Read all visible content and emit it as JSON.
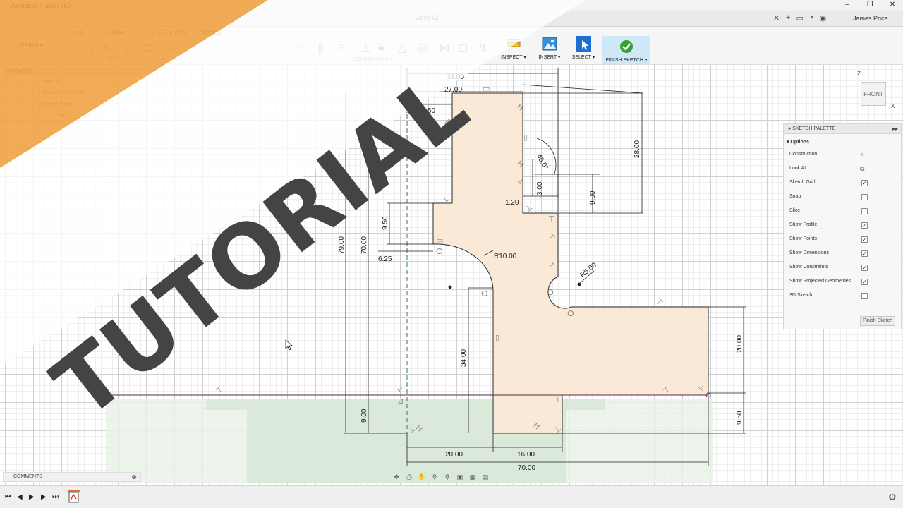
{
  "window": {
    "title": "Autodesk Fusion 360",
    "controls": [
      "–",
      "❐",
      "✕"
    ]
  },
  "tabs": {
    "doc_tab": "Valve v2",
    "user": "James Price"
  },
  "toolbar": {
    "workspace_tabs": [
      "SOLID",
      "SURFACE",
      "SHEET METAL",
      "TOOLS"
    ],
    "workspace_selector": "DESIGN ▾",
    "create_label": "CREATE ▾",
    "constraints_label": "CONSTRAINTS ▾",
    "inspect_label": "INSPECT ▾",
    "insert_label": "INSERT ▾",
    "select_label": "SELECT ▾",
    "finish_label": "FINISH SKETCH ▾"
  },
  "browser": {
    "header": "BROWSER",
    "items": [
      "Valve v2",
      "Document Settings",
      "Named Views",
      "Origin"
    ]
  },
  "comments": {
    "label": "COMMENTS"
  },
  "viewcube": {
    "face": "FRONT",
    "z_label": "Z",
    "x_label": "X"
  },
  "sketch_palette": {
    "header": "SKETCH PALETTE",
    "section": "Options",
    "options": [
      {
        "label": "Construction",
        "type": "icon",
        "icon": "construction-icon",
        "glyph": "<"
      },
      {
        "label": "Look At",
        "type": "icon",
        "icon": "look-at-icon",
        "glyph": "⧉"
      },
      {
        "label": "Sketch Grid",
        "type": "checkbox",
        "checked": true
      },
      {
        "label": "Snap",
        "type": "checkbox",
        "checked": false
      },
      {
        "label": "Slice",
        "type": "checkbox",
        "checked": false
      },
      {
        "label": "Show Profile",
        "type": "checkbox",
        "checked": true
      },
      {
        "label": "Show Points",
        "type": "checkbox",
        "checked": true
      },
      {
        "label": "Show Dimensions",
        "type": "checkbox",
        "checked": true
      },
      {
        "label": "Show Constraints",
        "type": "checkbox",
        "checked": true
      },
      {
        "label": "Show Projected Geometries",
        "type": "checkbox",
        "checked": true
      },
      {
        "label": "3D Sketch",
        "type": "checkbox",
        "checked": false
      }
    ],
    "finish_button": "Finish Sketch"
  },
  "dimensions": [
    {
      "id": "dim-33",
      "text": "33.00"
    },
    {
      "id": "dim-27",
      "text": "27.00"
    },
    {
      "id": "dim-1050",
      "text": "10.50"
    },
    {
      "id": "dim-28",
      "text": "28.00"
    },
    {
      "id": "dim-45deg",
      "text": "45.0°"
    },
    {
      "id": "dim-3",
      "text": "3.00"
    },
    {
      "id": "dim-9-top",
      "text": "9.00"
    },
    {
      "id": "dim-120",
      "text": "1.20"
    },
    {
      "id": "dim-950-left",
      "text": "9.50"
    },
    {
      "id": "dim-625",
      "text": "6.25"
    },
    {
      "id": "dim-r10",
      "text": "R10.00"
    },
    {
      "id": "dim-r5",
      "text": "R5.00"
    },
    {
      "id": "dim-79",
      "text": "79.00"
    },
    {
      "id": "dim-70-v",
      "text": "70.00"
    },
    {
      "id": "dim-34",
      "text": "34.00"
    },
    {
      "id": "dim-20-v",
      "text": "20.00"
    },
    {
      "id": "dim-9-bottom",
      "text": "9.00"
    },
    {
      "id": "dim-950-right",
      "text": "9.50"
    },
    {
      "id": "dim-20-h",
      "text": "20.00"
    },
    {
      "id": "dim-16",
      "text": "16.00"
    },
    {
      "id": "dim-70-h",
      "text": "70.00"
    }
  ],
  "overlay": {
    "banner_text": "TUTORIAL",
    "banner_color": "#f0a040",
    "text_color": "#454545"
  },
  "colors": {
    "profile_fill": "#fbe9d8",
    "profile_stroke": "#222222",
    "ground_fill": "#d9ead9",
    "finish_highlight": "#cfe8f7",
    "select_blue": "#1e6fd0"
  }
}
